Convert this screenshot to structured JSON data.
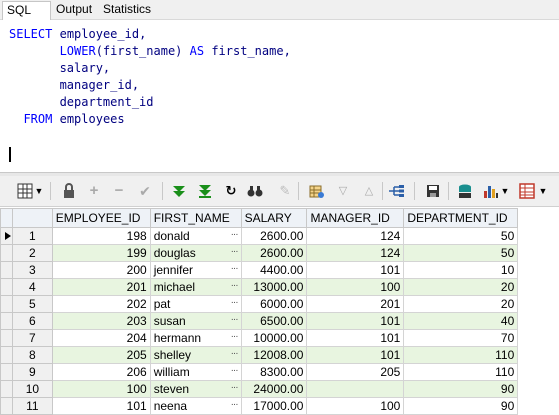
{
  "tabs": [
    {
      "label": "SQL"
    },
    {
      "label": "Output"
    },
    {
      "label": "Statistics"
    }
  ],
  "sql": {
    "select": "SELECT",
    "col1": "employee_id,",
    "lower": "LOWER",
    "lower_arg": "(first_name)",
    "as": "AS",
    "alias": "first_name,",
    "col3": "salary,",
    "col4": "manager_id,",
    "col5": "department_id",
    "from": "FROM",
    "table": "employees"
  },
  "columns": [
    "EMPLOYEE_ID",
    "FIRST_NAME",
    "SALARY",
    "MANAGER_ID",
    "DEPARTMENT_ID"
  ],
  "rows": [
    {
      "n": "1",
      "employee_id": "198",
      "first_name": "donald",
      "salary": "2600.00",
      "manager_id": "124",
      "department_id": "50"
    },
    {
      "n": "2",
      "employee_id": "199",
      "first_name": "douglas",
      "salary": "2600.00",
      "manager_id": "124",
      "department_id": "50"
    },
    {
      "n": "3",
      "employee_id": "200",
      "first_name": "jennifer",
      "salary": "4400.00",
      "manager_id": "101",
      "department_id": "10"
    },
    {
      "n": "4",
      "employee_id": "201",
      "first_name": "michael",
      "salary": "13000.00",
      "manager_id": "100",
      "department_id": "20"
    },
    {
      "n": "5",
      "employee_id": "202",
      "first_name": "pat",
      "salary": "6000.00",
      "manager_id": "201",
      "department_id": "20"
    },
    {
      "n": "6",
      "employee_id": "203",
      "first_name": "susan",
      "salary": "6500.00",
      "manager_id": "101",
      "department_id": "40"
    },
    {
      "n": "7",
      "employee_id": "204",
      "first_name": "hermann",
      "salary": "10000.00",
      "manager_id": "101",
      "department_id": "70"
    },
    {
      "n": "8",
      "employee_id": "205",
      "first_name": "shelley",
      "salary": "12008.00",
      "manager_id": "101",
      "department_id": "110"
    },
    {
      "n": "9",
      "employee_id": "206",
      "first_name": "william",
      "salary": "8300.00",
      "manager_id": "205",
      "department_id": "110"
    },
    {
      "n": "10",
      "employee_id": "100",
      "first_name": "steven",
      "salary": "24000.00",
      "manager_id": "",
      "department_id": "90"
    },
    {
      "n": "11",
      "employee_id": "101",
      "first_name": "neena",
      "salary": "17000.00",
      "manager_id": "100",
      "department_id": "90"
    }
  ],
  "cell_ellipsis": "···",
  "colors": {
    "row_alt": "#e8f5e0",
    "header": "#eef2f7",
    "keyword": "#0000ff",
    "identifier": "#000080"
  },
  "toolbar_icons": [
    "grid-icon",
    "lock-icon",
    "add-icon",
    "remove-icon",
    "apply-icon",
    "filter-down-icon",
    "filter-all-icon",
    "refresh-icon",
    "find-icon",
    "clear-icon",
    "grid-view-icon",
    "sort-down-icon",
    "sort-up-icon",
    "chart-link-icon",
    "save-icon",
    "export-icon",
    "chart-icon",
    "table-options-icon"
  ]
}
